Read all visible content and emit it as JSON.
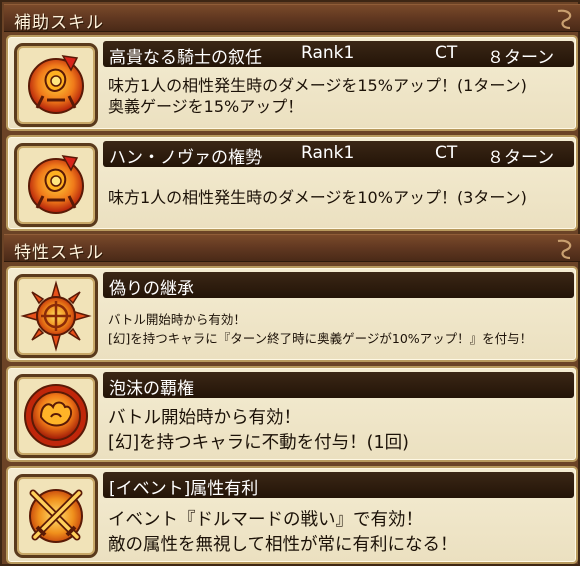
{
  "sections": [
    {
      "title": "補助スキル"
    },
    {
      "title": "特性スキル"
    }
  ],
  "support_skills": [
    {
      "name": "高貴なる騎士の叙任",
      "rank": "Rank1",
      "ct_label": "CT",
      "ct_value": "８ターン",
      "lines": [
        "味方1人の相性発生時のダメージを15%アップ！(1ターン)",
        "奥義ゲージを15%アップ！"
      ],
      "icon": "flame-gauntlet-icon"
    },
    {
      "name": "ハン・ノヴァの権勢",
      "rank": "Rank1",
      "ct_label": "CT",
      "ct_value": "８ターン",
      "lines": [
        "味方1人の相性発生時のダメージを10%アップ！(3ターン)"
      ],
      "icon": "flame-gauntlet-icon"
    }
  ],
  "trait_skills": [
    {
      "name": "偽りの継承",
      "lines": [
        "バトル開始時から有効！",
        "[幻]を持つキャラに『ターン終了時に奥義ゲージが10%アップ！』を付与！"
      ],
      "icon": "crosshair-sun-icon"
    },
    {
      "name": "泡沫の覇権",
      "lines": [
        "バトル開始時から有効！",
        "[幻]を持つキャラに不動を付与！(1回)"
      ],
      "icon": "strong-arm-icon"
    },
    {
      "name": "[イベント]属性有利",
      "lines": [
        "イベント『ドルマードの戦い』で有効！",
        "敵の属性を無視して相性が常に有利になる！"
      ],
      "icon": "crossed-swords-icon"
    }
  ],
  "colors": {
    "panel_brown": "#6b4326",
    "card_cream": "#f4ecd2",
    "name_bar": "#2c1b0c",
    "icon_orange": "#f07a1a",
    "icon_red": "#b01a0a"
  }
}
